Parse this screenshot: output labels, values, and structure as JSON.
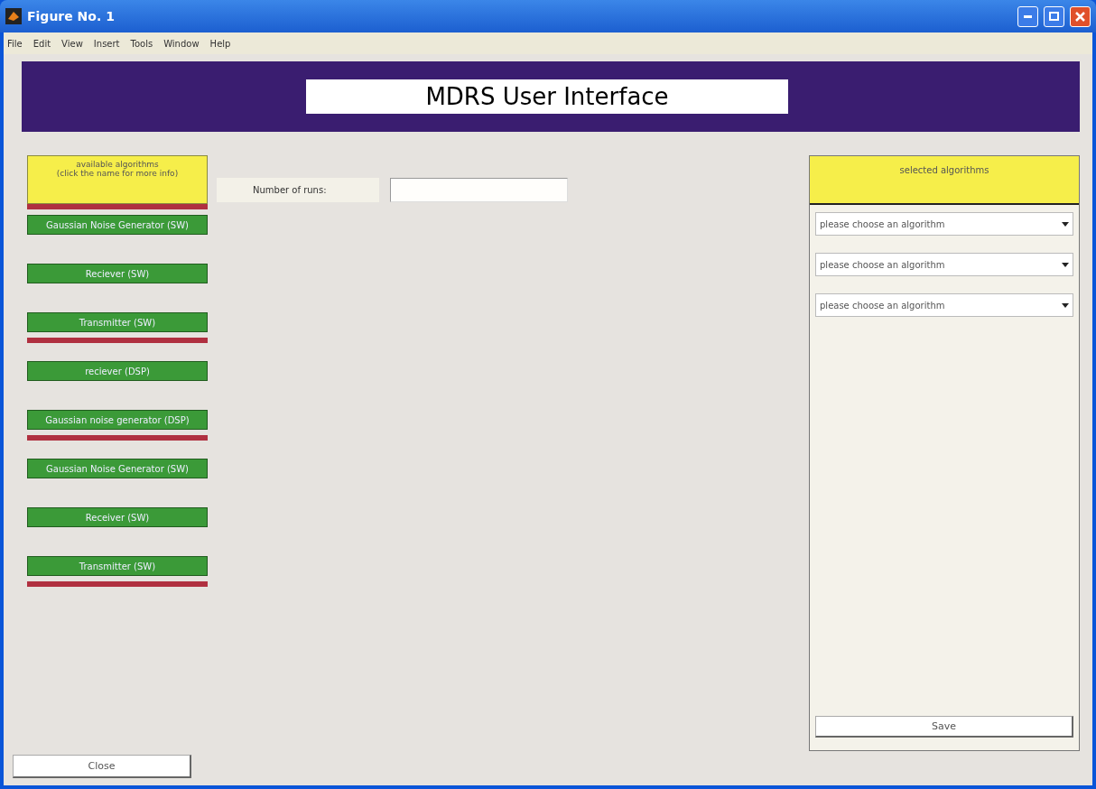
{
  "window": {
    "title": "Figure No. 1"
  },
  "menu": [
    "File",
    "Edit",
    "View",
    "Insert",
    "Tools",
    "Window",
    "Help"
  ],
  "banner": {
    "title": "MDRS User Interface"
  },
  "available": {
    "header_lines": [
      "available algorithms",
      "(click the name for more info)"
    ],
    "marked": true,
    "items": [
      {
        "label": "Gaussian Noise Generator (SW)",
        "marked": false
      },
      {
        "label": "Reciever (SW)",
        "marked": false
      },
      {
        "label": "Transmitter (SW)",
        "marked": true
      },
      {
        "label": "reciever (DSP)",
        "marked": false
      },
      {
        "label": "Gaussian noise generator (DSP)",
        "marked": true
      },
      {
        "label": "Gaussian Noise Generator (SW)",
        "marked": false
      },
      {
        "label": "Receiver (SW)",
        "marked": false
      },
      {
        "label": "Transmitter (SW)",
        "marked": true
      }
    ]
  },
  "runs": {
    "label": "Number of runs:"
  },
  "selected": {
    "header": "selected algorithms",
    "dropdowns": [
      {
        "value": "please choose an algorithm"
      },
      {
        "value": "please choose an algorithm"
      },
      {
        "value": "please choose an algorithm"
      }
    ],
    "save": "Save"
  },
  "close": "Close"
}
